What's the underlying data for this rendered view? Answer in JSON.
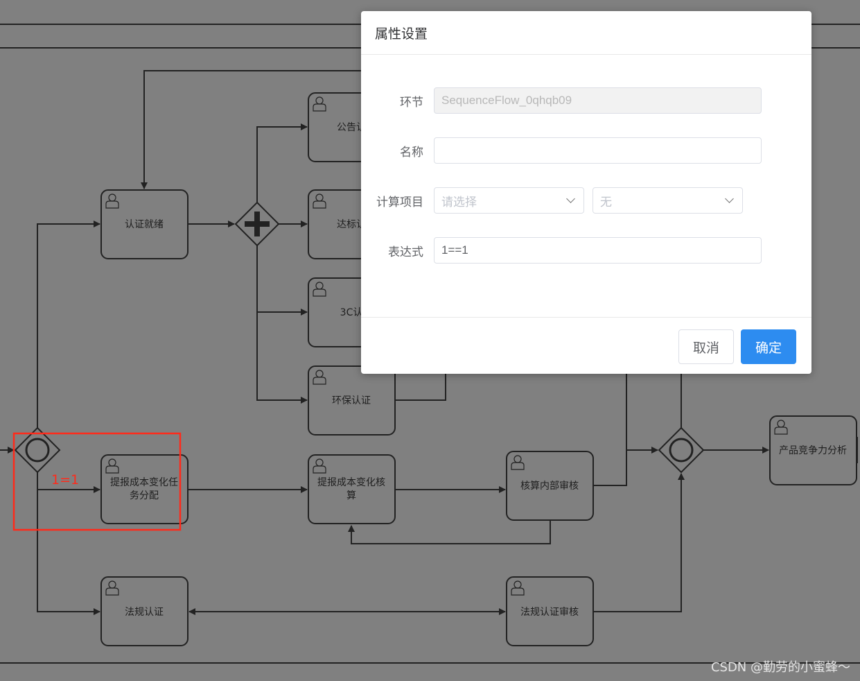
{
  "diagram": {
    "tasks": {
      "announce": "公告认",
      "cert_ready": "认证就绪",
      "standard": "达标认",
      "ccc": "3C认",
      "env": "环保认证",
      "cost_assign_1": "提报成本变化任",
      "cost_assign_2": "务分配",
      "cost_calc_1": "提报成本变化核",
      "cost_calc_2": "算",
      "internal_review": "核算内部审核",
      "competitiveness": "产品竞争力分析",
      "regulation": "法规认证",
      "regulation_review": "法规认证审核"
    },
    "flow_label": "1=1",
    "highlight_color": "#ff2a1a"
  },
  "dialog": {
    "title": "属性设置",
    "fields": {
      "node_label": "环节",
      "node_value": "SequenceFlow_0qhqb09",
      "name_label": "名称",
      "name_value": "",
      "calc_label": "计算项目",
      "calc_placeholder": "请选择",
      "calc_second": "无",
      "expr_label": "表达式",
      "expr_value": "1==1"
    },
    "cancel": "取消",
    "ok": "确定",
    "accent": "#2d8cf0"
  },
  "watermark": "CSDN @勤劳的小蜜蜂～"
}
